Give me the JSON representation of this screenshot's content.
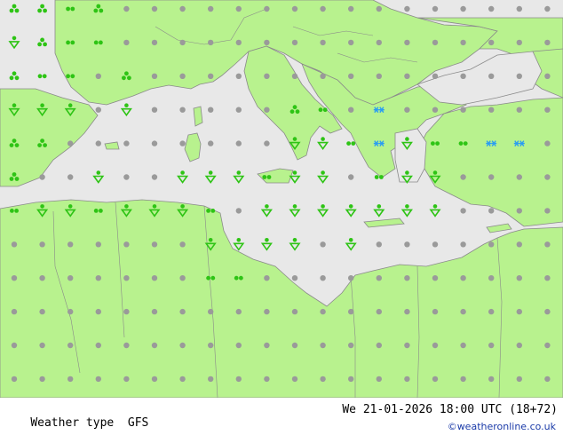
{
  "footer": {
    "product_label": "Weather type",
    "model": "GFS",
    "valid_time": "We 21-01-2026 18:00 UTC (18+72)",
    "credit": "©weatheronline.co.uk"
  },
  "colors": {
    "land": "#b8f28e",
    "sea": "#e8e8e8",
    "border": "#8a8a8a",
    "no_weather_dot": "#9a9a9a",
    "rain": "#2ec415",
    "snow": "#2a9df2"
  },
  "symbol_legend": {
    "dot": "no significant weather",
    "drizzle": "drizzle",
    "rain_showers": "rain showers",
    "showers": "showers",
    "snow": "snow"
  },
  "icon_names": [
    "dot-icon",
    "drizzle-icon",
    "rain-shower-icon",
    "showers-icon",
    "snow-icon"
  ]
}
